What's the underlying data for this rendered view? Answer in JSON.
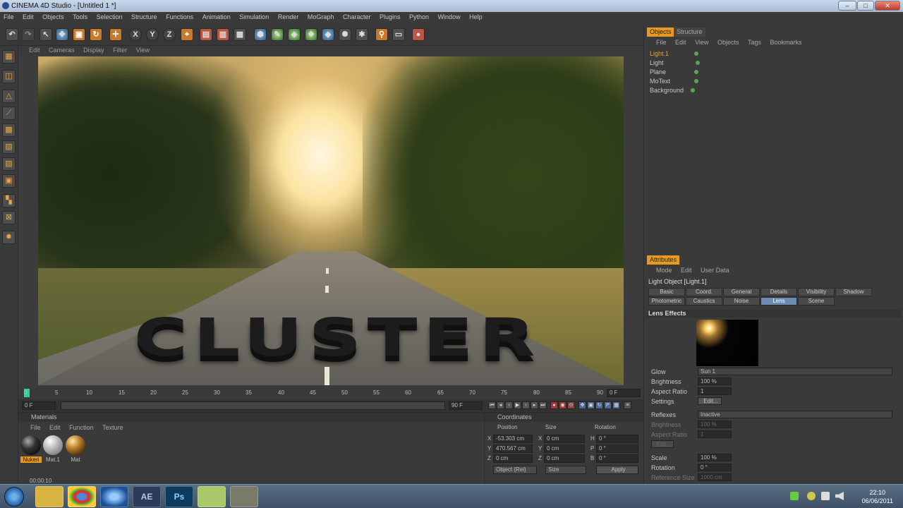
{
  "window": {
    "title": "CINEMA 4D Studio - [Untitled 1 *]",
    "minimize": "‒",
    "maximize": "□",
    "close": "✕"
  },
  "menubar": [
    "File",
    "Edit",
    "Objects",
    "Tools",
    "Selection",
    "Structure",
    "Functions",
    "Animation",
    "Simulation",
    "Render",
    "MoGraph",
    "Character",
    "Plugins",
    "Python",
    "Window",
    "Help"
  ],
  "toolbar": {
    "x_label": "X",
    "y_label": "Y",
    "z_label": "Z"
  },
  "viewport": {
    "menu": [
      "Edit",
      "Cameras",
      "Display",
      "Filter",
      "View"
    ],
    "text3d": "CLUSTER"
  },
  "timeline": {
    "ticks": [
      "0",
      "5",
      "10",
      "15",
      "20",
      "25",
      "30",
      "35",
      "40",
      "45",
      "50",
      "55",
      "60",
      "65",
      "70",
      "75",
      "80",
      "85",
      "90"
    ],
    "frame_end_field": "0 F",
    "current_field": "0 F",
    "start_field": "0 F",
    "end_field": "90 F"
  },
  "materials": {
    "title": "Materials",
    "menu": [
      "File",
      "Edit",
      "Function",
      "Texture"
    ],
    "items": [
      {
        "label": "Nukeri"
      },
      {
        "label": "Mat.1"
      },
      {
        "label": "Mat"
      }
    ],
    "time": "00:00:10"
  },
  "coordinates": {
    "title": "Coordinates",
    "col_position": "Position",
    "col_size": "Size",
    "col_rotation": "Rotation",
    "rows": [
      {
        "axis": "X",
        "pos": "-53.303 cm",
        "size_axis": "X",
        "size": "0 cm",
        "rot_axis": "H",
        "rot": "0 °"
      },
      {
        "axis": "Y",
        "pos": "470.567 cm",
        "size_axis": "Y",
        "size": "0 cm",
        "rot_axis": "P",
        "rot": "0 °"
      },
      {
        "axis": "Z",
        "pos": "0 cm",
        "size_axis": "Z",
        "size": "0 cm",
        "rot_axis": "B",
        "rot": "0 °"
      }
    ],
    "mode": "Object (Rel)",
    "size_mode": "Size",
    "apply": "Apply"
  },
  "objects": {
    "tabs": [
      "Objects",
      "Structure"
    ],
    "menu": [
      "File",
      "Edit",
      "View",
      "Objects",
      "Tags",
      "Bookmarks"
    ],
    "items": [
      "Light.1",
      "Light",
      "Plane",
      "MoText",
      "Background"
    ]
  },
  "attributes": {
    "title": "Attributes",
    "menu": [
      "Mode",
      "Edit",
      "User Data"
    ],
    "object_title": "Light Object [Light.1]",
    "tabs_row1": [
      "Basic",
      "Coord.",
      "General",
      "Details",
      "Visibility",
      "Shadow"
    ],
    "tabs_row2": [
      "Photometric",
      "Caustics",
      "Noise",
      "Lens",
      "Scene"
    ],
    "section": "Lens Effects",
    "glow_label": "Glow",
    "glow_value": "Sun 1",
    "brightness_label": "Brightness",
    "brightness_value": "100 %",
    "aspect_label": "Aspect Ratio",
    "aspect_value": "1",
    "settings_label": "Settings",
    "settings_btn": "Edit...",
    "reflexes_label": "Reflexes",
    "reflexes_value": "Inactive",
    "brightness2_label": "Brightness",
    "brightness2_value": "100 %",
    "aspect2_label": "Aspect Ratio",
    "aspect2_value": "1",
    "edit2_btn": "Edit...",
    "scale_label": "Scale",
    "scale_value": "100 %",
    "rotation_label": "Rotation",
    "rotation_value": "0 °",
    "refsize_label": "Reference Size",
    "refsize_value": "1000 cm"
  },
  "taskbar": {
    "apps": [
      "",
      "",
      "",
      "",
      "AE",
      "Ps",
      "",
      ""
    ],
    "time": "22:10",
    "date": "06/06/2011"
  }
}
